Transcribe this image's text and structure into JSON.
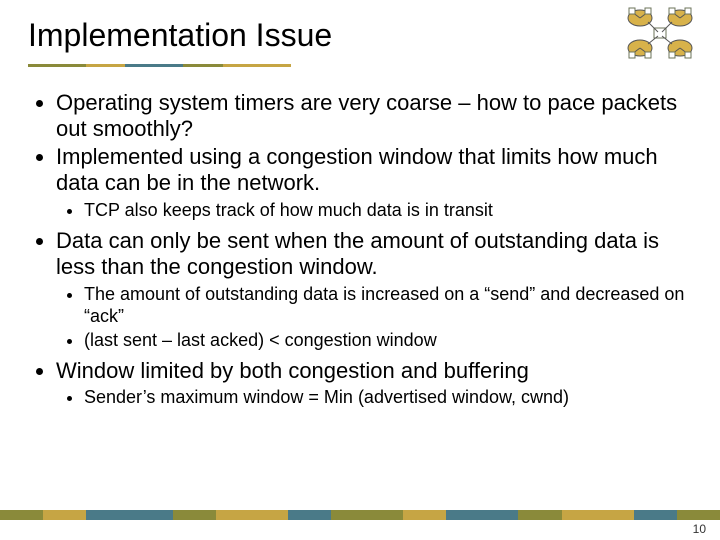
{
  "title": "Implementation Issue",
  "bullets": {
    "b1": "Operating system timers are very coarse – how to pace packets out smoothly?",
    "b2": "Implemented using a congestion window that limits how much data can be in the network.",
    "b2s1": "TCP also keeps track of how much data is in transit",
    "b3": "Data can only be sent when the amount of outstanding data is less than the congestion window.",
    "b3s1": "The amount of outstanding data is increased on a “send” and decreased on “ack”",
    "b3s2": "(last sent – last acked) < congestion window",
    "b4": "Window limited by both congestion and buffering",
    "b4s1": "Sender’s maximum window = Min (advertised window, cwnd)"
  },
  "page_number": "10",
  "palette": {
    "olive": "#8a8a3a",
    "gold": "#c6a544",
    "teal": "#4a7a88",
    "node": "#d8b24a",
    "box": "#6b735a"
  }
}
